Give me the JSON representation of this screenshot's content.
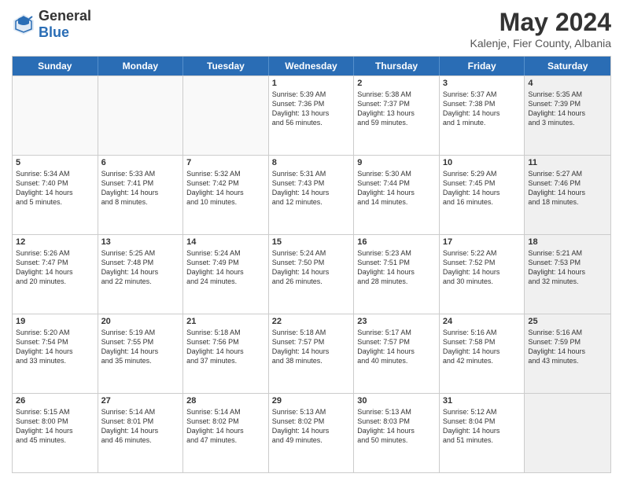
{
  "header": {
    "logo_general": "General",
    "logo_blue": "Blue",
    "month_title": "May 2024",
    "location": "Kalenje, Fier County, Albania"
  },
  "days_of_week": [
    "Sunday",
    "Monday",
    "Tuesday",
    "Wednesday",
    "Thursday",
    "Friday",
    "Saturday"
  ],
  "rows": [
    [
      {
        "day": "",
        "lines": [],
        "empty": true
      },
      {
        "day": "",
        "lines": [],
        "empty": true
      },
      {
        "day": "",
        "lines": [],
        "empty": true
      },
      {
        "day": "1",
        "lines": [
          "Sunrise: 5:39 AM",
          "Sunset: 7:36 PM",
          "Daylight: 13 hours",
          "and 56 minutes."
        ]
      },
      {
        "day": "2",
        "lines": [
          "Sunrise: 5:38 AM",
          "Sunset: 7:37 PM",
          "Daylight: 13 hours",
          "and 59 minutes."
        ]
      },
      {
        "day": "3",
        "lines": [
          "Sunrise: 5:37 AM",
          "Sunset: 7:38 PM",
          "Daylight: 14 hours",
          "and 1 minute."
        ]
      },
      {
        "day": "4",
        "lines": [
          "Sunrise: 5:35 AM",
          "Sunset: 7:39 PM",
          "Daylight: 14 hours",
          "and 3 minutes."
        ],
        "shaded": true
      }
    ],
    [
      {
        "day": "5",
        "lines": [
          "Sunrise: 5:34 AM",
          "Sunset: 7:40 PM",
          "Daylight: 14 hours",
          "and 5 minutes."
        ]
      },
      {
        "day": "6",
        "lines": [
          "Sunrise: 5:33 AM",
          "Sunset: 7:41 PM",
          "Daylight: 14 hours",
          "and 8 minutes."
        ]
      },
      {
        "day": "7",
        "lines": [
          "Sunrise: 5:32 AM",
          "Sunset: 7:42 PM",
          "Daylight: 14 hours",
          "and 10 minutes."
        ]
      },
      {
        "day": "8",
        "lines": [
          "Sunrise: 5:31 AM",
          "Sunset: 7:43 PM",
          "Daylight: 14 hours",
          "and 12 minutes."
        ]
      },
      {
        "day": "9",
        "lines": [
          "Sunrise: 5:30 AM",
          "Sunset: 7:44 PM",
          "Daylight: 14 hours",
          "and 14 minutes."
        ]
      },
      {
        "day": "10",
        "lines": [
          "Sunrise: 5:29 AM",
          "Sunset: 7:45 PM",
          "Daylight: 14 hours",
          "and 16 minutes."
        ]
      },
      {
        "day": "11",
        "lines": [
          "Sunrise: 5:27 AM",
          "Sunset: 7:46 PM",
          "Daylight: 14 hours",
          "and 18 minutes."
        ],
        "shaded": true
      }
    ],
    [
      {
        "day": "12",
        "lines": [
          "Sunrise: 5:26 AM",
          "Sunset: 7:47 PM",
          "Daylight: 14 hours",
          "and 20 minutes."
        ]
      },
      {
        "day": "13",
        "lines": [
          "Sunrise: 5:25 AM",
          "Sunset: 7:48 PM",
          "Daylight: 14 hours",
          "and 22 minutes."
        ]
      },
      {
        "day": "14",
        "lines": [
          "Sunrise: 5:24 AM",
          "Sunset: 7:49 PM",
          "Daylight: 14 hours",
          "and 24 minutes."
        ]
      },
      {
        "day": "15",
        "lines": [
          "Sunrise: 5:24 AM",
          "Sunset: 7:50 PM",
          "Daylight: 14 hours",
          "and 26 minutes."
        ]
      },
      {
        "day": "16",
        "lines": [
          "Sunrise: 5:23 AM",
          "Sunset: 7:51 PM",
          "Daylight: 14 hours",
          "and 28 minutes."
        ]
      },
      {
        "day": "17",
        "lines": [
          "Sunrise: 5:22 AM",
          "Sunset: 7:52 PM",
          "Daylight: 14 hours",
          "and 30 minutes."
        ]
      },
      {
        "day": "18",
        "lines": [
          "Sunrise: 5:21 AM",
          "Sunset: 7:53 PM",
          "Daylight: 14 hours",
          "and 32 minutes."
        ],
        "shaded": true
      }
    ],
    [
      {
        "day": "19",
        "lines": [
          "Sunrise: 5:20 AM",
          "Sunset: 7:54 PM",
          "Daylight: 14 hours",
          "and 33 minutes."
        ]
      },
      {
        "day": "20",
        "lines": [
          "Sunrise: 5:19 AM",
          "Sunset: 7:55 PM",
          "Daylight: 14 hours",
          "and 35 minutes."
        ]
      },
      {
        "day": "21",
        "lines": [
          "Sunrise: 5:18 AM",
          "Sunset: 7:56 PM",
          "Daylight: 14 hours",
          "and 37 minutes."
        ]
      },
      {
        "day": "22",
        "lines": [
          "Sunrise: 5:18 AM",
          "Sunset: 7:57 PM",
          "Daylight: 14 hours",
          "and 38 minutes."
        ]
      },
      {
        "day": "23",
        "lines": [
          "Sunrise: 5:17 AM",
          "Sunset: 7:57 PM",
          "Daylight: 14 hours",
          "and 40 minutes."
        ]
      },
      {
        "day": "24",
        "lines": [
          "Sunrise: 5:16 AM",
          "Sunset: 7:58 PM",
          "Daylight: 14 hours",
          "and 42 minutes."
        ]
      },
      {
        "day": "25",
        "lines": [
          "Sunrise: 5:16 AM",
          "Sunset: 7:59 PM",
          "Daylight: 14 hours",
          "and 43 minutes."
        ],
        "shaded": true
      }
    ],
    [
      {
        "day": "26",
        "lines": [
          "Sunrise: 5:15 AM",
          "Sunset: 8:00 PM",
          "Daylight: 14 hours",
          "and 45 minutes."
        ]
      },
      {
        "day": "27",
        "lines": [
          "Sunrise: 5:14 AM",
          "Sunset: 8:01 PM",
          "Daylight: 14 hours",
          "and 46 minutes."
        ]
      },
      {
        "day": "28",
        "lines": [
          "Sunrise: 5:14 AM",
          "Sunset: 8:02 PM",
          "Daylight: 14 hours",
          "and 47 minutes."
        ]
      },
      {
        "day": "29",
        "lines": [
          "Sunrise: 5:13 AM",
          "Sunset: 8:02 PM",
          "Daylight: 14 hours",
          "and 49 minutes."
        ]
      },
      {
        "day": "30",
        "lines": [
          "Sunrise: 5:13 AM",
          "Sunset: 8:03 PM",
          "Daylight: 14 hours",
          "and 50 minutes."
        ]
      },
      {
        "day": "31",
        "lines": [
          "Sunrise: 5:12 AM",
          "Sunset: 8:04 PM",
          "Daylight: 14 hours",
          "and 51 minutes."
        ]
      },
      {
        "day": "",
        "lines": [],
        "empty": true,
        "shaded": true
      }
    ]
  ]
}
